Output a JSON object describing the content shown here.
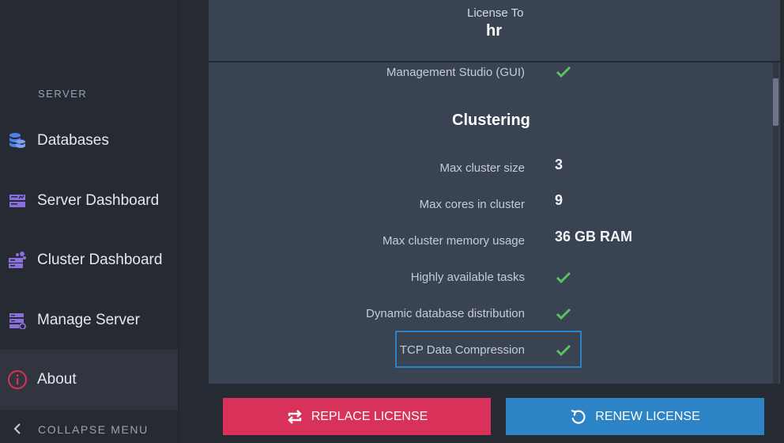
{
  "sidebar": {
    "section_label": "SERVER",
    "items": [
      {
        "label": "Databases",
        "icon": "databases-icon",
        "color": "#4f7fe8"
      },
      {
        "label": "Server Dashboard",
        "icon": "server-dashboard-icon",
        "color": "#8a6fdd"
      },
      {
        "label": "Cluster Dashboard",
        "icon": "cluster-dashboard-icon",
        "color": "#8a6fdd"
      },
      {
        "label": "Manage Server",
        "icon": "manage-server-icon",
        "color": "#8a6fdd"
      },
      {
        "label": "About",
        "icon": "info-icon",
        "color": "#d8325a",
        "active": true
      }
    ],
    "collapse_label": "COLLAPSE MENU"
  },
  "license": {
    "to_label": "License To",
    "name": "hr"
  },
  "features": {
    "management_studio": "Management Studio (GUI)",
    "clustering_title": "Clustering",
    "rows": [
      {
        "label": "Max cluster size",
        "value": "3"
      },
      {
        "label": "Max cores in cluster",
        "value": "9"
      },
      {
        "label": "Max cluster memory usage",
        "value": "36 GB RAM"
      },
      {
        "label": "Highly available tasks",
        "value": "check"
      },
      {
        "label": "Dynamic database distribution",
        "value": "check"
      },
      {
        "label": "TCP Data Compression",
        "value": "check"
      }
    ]
  },
  "buttons": {
    "replace": "REPLACE LICENSE",
    "renew": "RENEW LICENSE"
  },
  "colors": {
    "check": "#5cc35c",
    "replace_bg": "#d8325a",
    "renew_bg": "#2c83c6",
    "highlight": "#2b82c9"
  }
}
